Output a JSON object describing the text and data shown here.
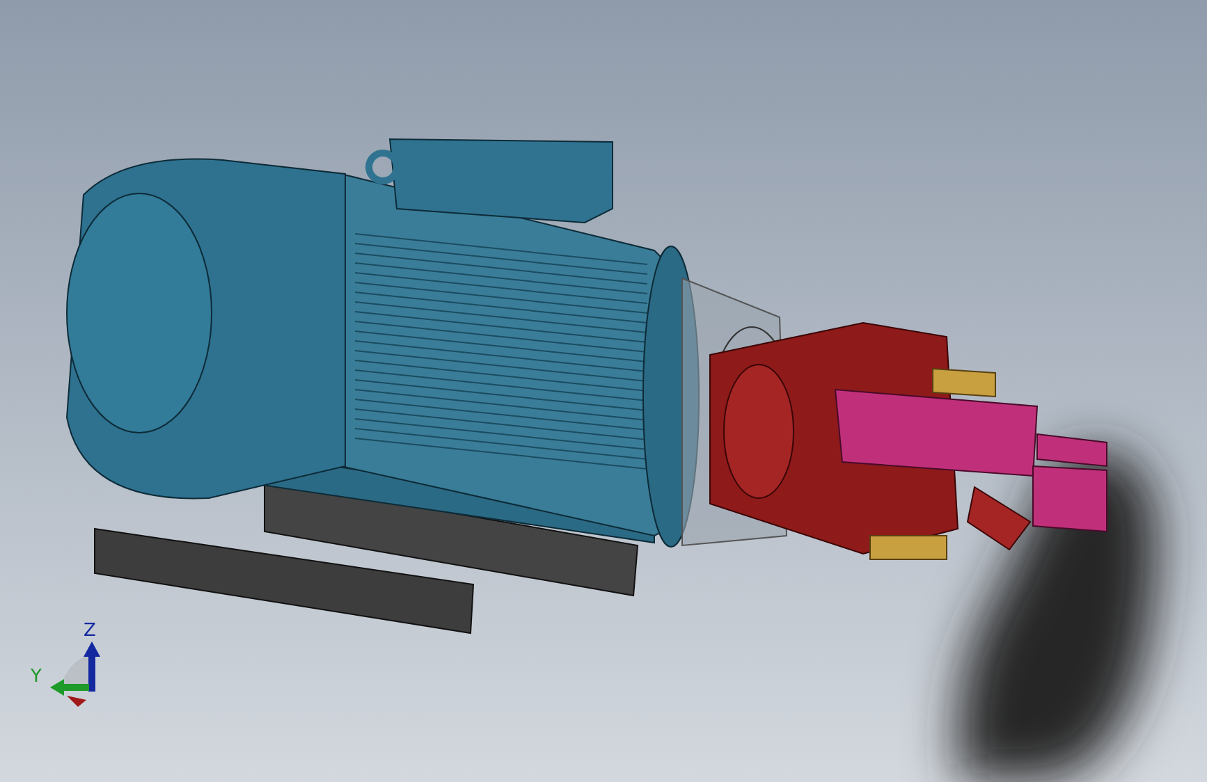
{
  "viewport": {
    "triad": {
      "axes": [
        {
          "kind": "z",
          "label": "Z"
        },
        {
          "kind": "y",
          "label": "Y"
        }
      ]
    }
  }
}
